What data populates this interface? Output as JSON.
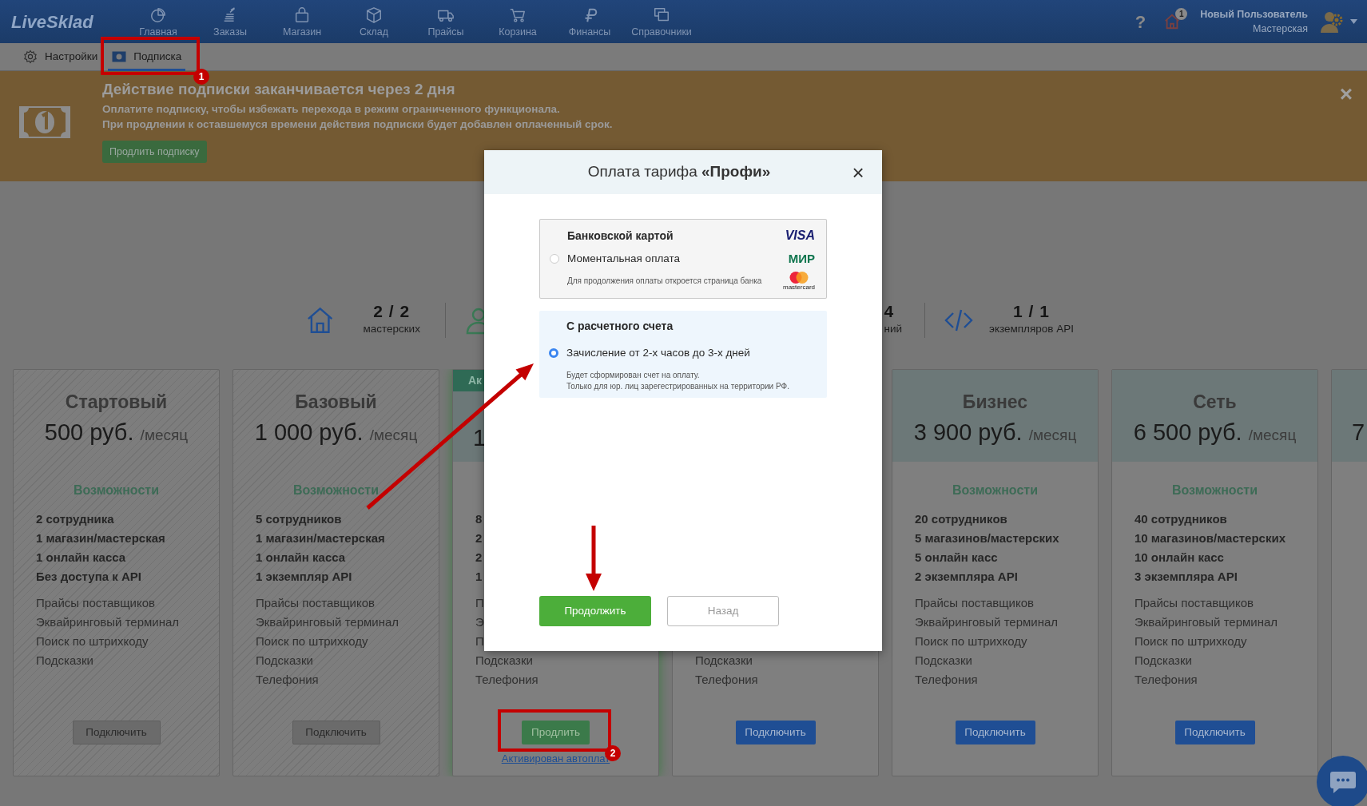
{
  "navbar": {
    "logo": "LiveSklad",
    "items": [
      {
        "label": "Главная",
        "kind": "chart"
      },
      {
        "label": "Заказы",
        "kind": "coins"
      },
      {
        "label": "Магазин",
        "kind": "bag"
      },
      {
        "label": "Склад",
        "kind": "box"
      },
      {
        "label": "Прайсы",
        "kind": "truck"
      },
      {
        "label": "Корзина",
        "kind": "cart"
      },
      {
        "label": "Финансы",
        "kind": "ruble"
      },
      {
        "label": "Справочники",
        "kind": "windows"
      }
    ],
    "help": "?",
    "notifications": "1",
    "user_name": "Новый Пользователь",
    "user_role": "Мастерская"
  },
  "subnav": {
    "items": [
      {
        "label": "Настройки",
        "kind": "gear",
        "selected": false
      },
      {
        "label": "Подписка",
        "kind": "money",
        "selected": true
      }
    ]
  },
  "banner": {
    "title": "Действие подписки заканчивается через 2 дня",
    "lines": [
      "Оплатите подписку, чтобы избежать перехода в режим ограниченного функционала.",
      "При продлении к оставшемуся времени действия подписки будет добавлен оплаченный срок."
    ],
    "button": "Продлить подписку",
    "close": "×"
  },
  "stats": [
    {
      "kind": "home",
      "value": "2 / 2",
      "label": "мастерских"
    },
    {
      "kind": "user"
    },
    {
      "value": "4",
      "label": "ний"
    },
    {
      "kind": "code",
      "value": "1 / 1",
      "label": "экземпляров API"
    }
  ],
  "plans": [
    {
      "kind": "disabled",
      "title": "Стартовый",
      "price": "500 руб.",
      "period": "/месяц",
      "heading": "Возможности",
      "limits": [
        "2 сотрудника",
        "1 магазин/мастерская",
        "1 онлайн касса",
        "Без доступа к API"
      ],
      "features": [
        "Прайсы поставщиков",
        "Эквайринговый терминал",
        "Поиск по штрихкоду",
        "Подсказки"
      ],
      "button": "Подключить"
    },
    {
      "kind": "disabled",
      "title": "Базовый",
      "price": "1 000 руб.",
      "period": "/месяц",
      "heading": "Возможности",
      "limits": [
        "5 сотрудников",
        "1 магазин/мастерская",
        "1 онлайн касса",
        "1 экземпляр API"
      ],
      "features": [
        "Прайсы поставщиков",
        "Эквайринговый терминал",
        "Поиск по штрихкоду",
        "Подсказки",
        "Телефония"
      ],
      "button": "Подключить"
    },
    {
      "kind": "active",
      "tag": "Ак",
      "price": "1",
      "limits": [
        "8",
        "2",
        "2",
        "1"
      ],
      "features": [
        "П",
        "Э",
        "П",
        "Подсказки",
        "Телефония"
      ],
      "button": "Продлить",
      "link": "Активирован автоплат"
    },
    {
      "kind": "available",
      "features": [
        "Подсказки",
        "Телефония"
      ],
      "button": "Подключить"
    },
    {
      "kind": "available",
      "title": "Бизнес",
      "price": "3 900 руб.",
      "period": "/месяц",
      "heading": "Возможности",
      "limits": [
        "20 сотрудников",
        "5 магазинов/мастерских",
        "5 онлайн касс",
        "2 экземпляра API"
      ],
      "features": [
        "Прайсы поставщиков",
        "Эквайринговый терминал",
        "Поиск по штрихкоду",
        "Подсказки",
        "Телефония"
      ],
      "button": "Подключить"
    },
    {
      "kind": "available",
      "title": "Сеть",
      "price": "6 500 руб.",
      "period": "/месяц",
      "heading": "Возможности",
      "limits": [
        "40 сотрудников",
        "10 магазинов/мастерских",
        "10 онлайн касс",
        "3 экземпляра API"
      ],
      "features": [
        "Прайсы поставщиков",
        "Эквайринговый терминал",
        "Поиск по штрихкоду",
        "Подсказки",
        "Телефония"
      ],
      "button": "Подключить"
    },
    {
      "kind": "available",
      "price": "7"
    }
  ],
  "modal": {
    "title": "Оплата тарифа **«Профи»**",
    "close": "×",
    "options": [
      {
        "title": "Банковской картой",
        "subtitle": "Моментальная оплата",
        "notes": [
          "Для продолжения оплаты откроется страница банка"
        ],
        "selected": false,
        "brands": [
          "VISA",
          "МИР",
          "mastercard"
        ]
      },
      {
        "title": "С расчетного счета",
        "subtitle": "Зачисление от 2-х часов до 3-х дней",
        "notes": [
          "Будет сформирован счет на оплату.",
          "Только для юр. лиц зарегестрированных на территории РФ."
        ],
        "selected": true
      }
    ],
    "buttons": [
      {
        "label": "Продолжить",
        "kind": "primary"
      },
      {
        "label": "Назад",
        "kind": "secondary"
      }
    ]
  },
  "annotations": [
    {
      "number": "1"
    },
    {
      "number": "2"
    }
  ]
}
